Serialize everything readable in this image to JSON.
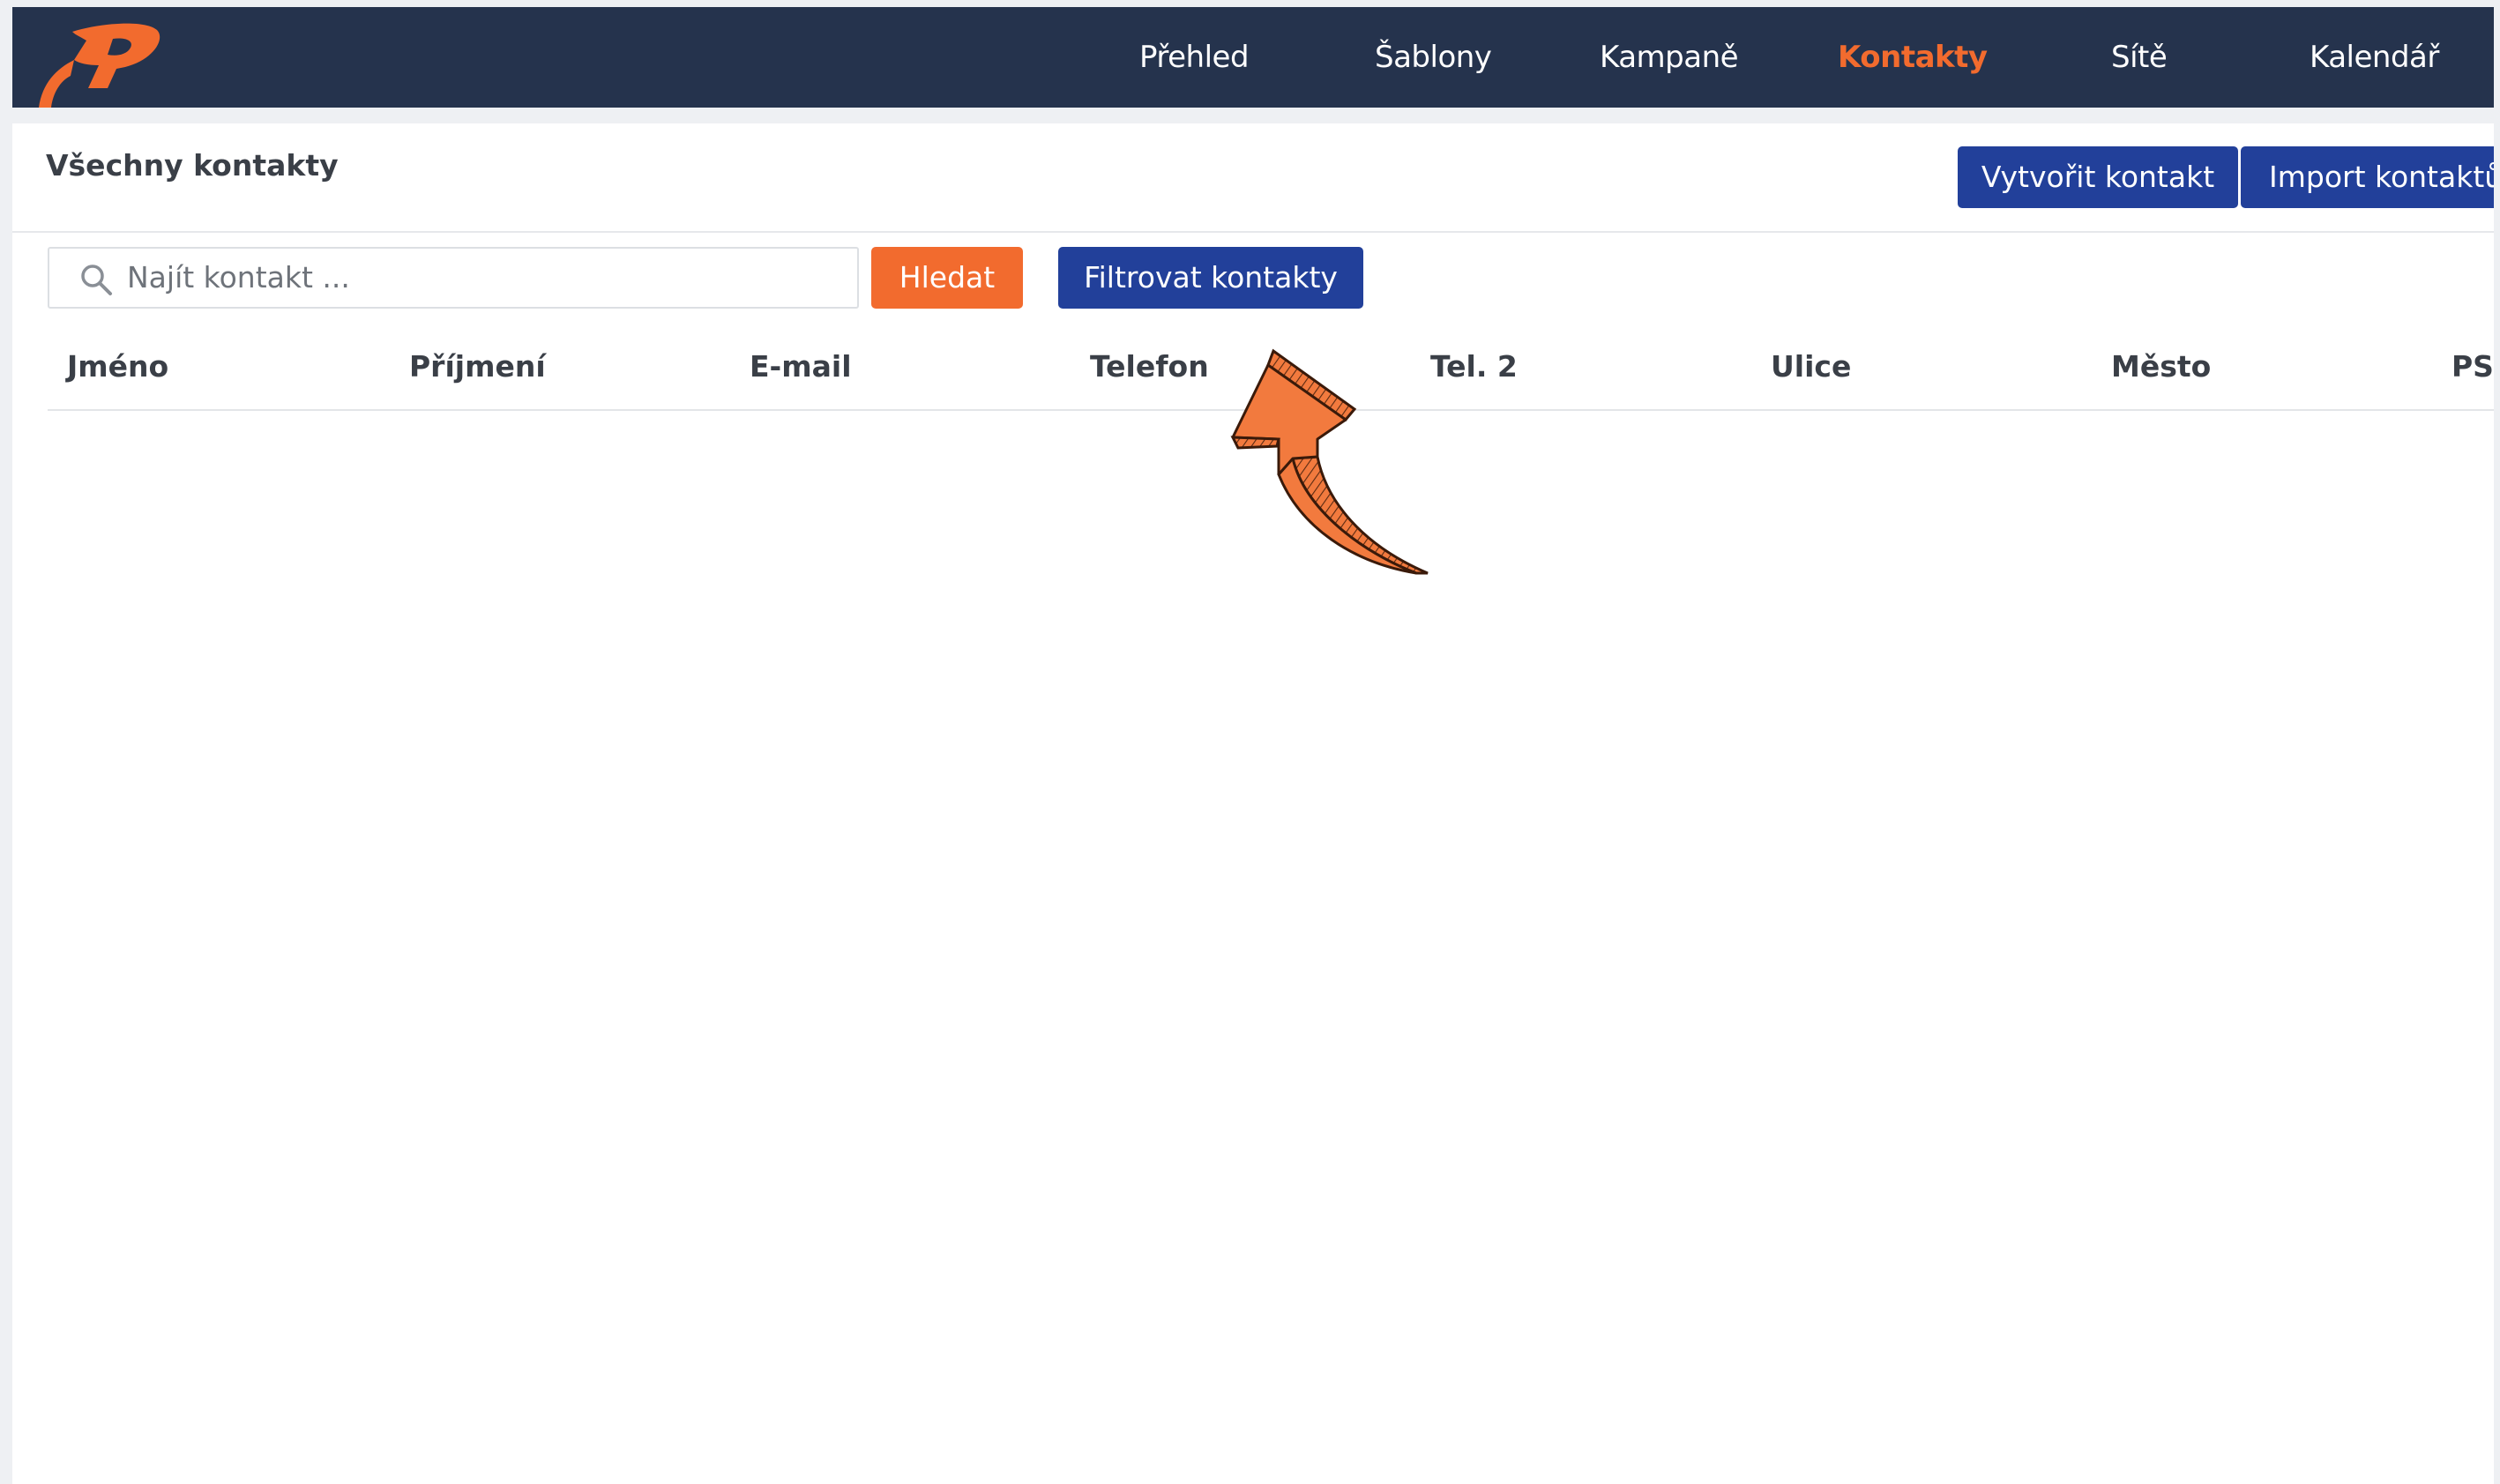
{
  "nav": {
    "items": [
      {
        "label": "Přehled",
        "active": false
      },
      {
        "label": "Šablony",
        "active": false
      },
      {
        "label": "Kampaně",
        "active": false
      },
      {
        "label": "Kontakty",
        "active": true
      },
      {
        "label": "Sítě",
        "active": false
      },
      {
        "label": "Kalendář",
        "active": false
      }
    ]
  },
  "header": {
    "title": "Všechny kontakty",
    "create_button": "Vytvořit kontakt",
    "import_button": "Import kontaktů"
  },
  "search": {
    "placeholder": "Najít kontakt ...",
    "search_button": "Hledat",
    "filter_button": "Filtrovat kontakty"
  },
  "table": {
    "columns": [
      "Jméno",
      "Příjmení",
      "E-mail",
      "Telefon",
      "Tel. 2",
      "Ulice",
      "Město",
      "PSČ"
    ]
  },
  "colors": {
    "nav_bg": "#25334d",
    "accent_orange": "#f26b2e",
    "primary_blue": "#22409a"
  },
  "icons": {
    "logo": "rocket-logo",
    "search": "search-icon",
    "annotation": "curved-arrow-pointer"
  }
}
